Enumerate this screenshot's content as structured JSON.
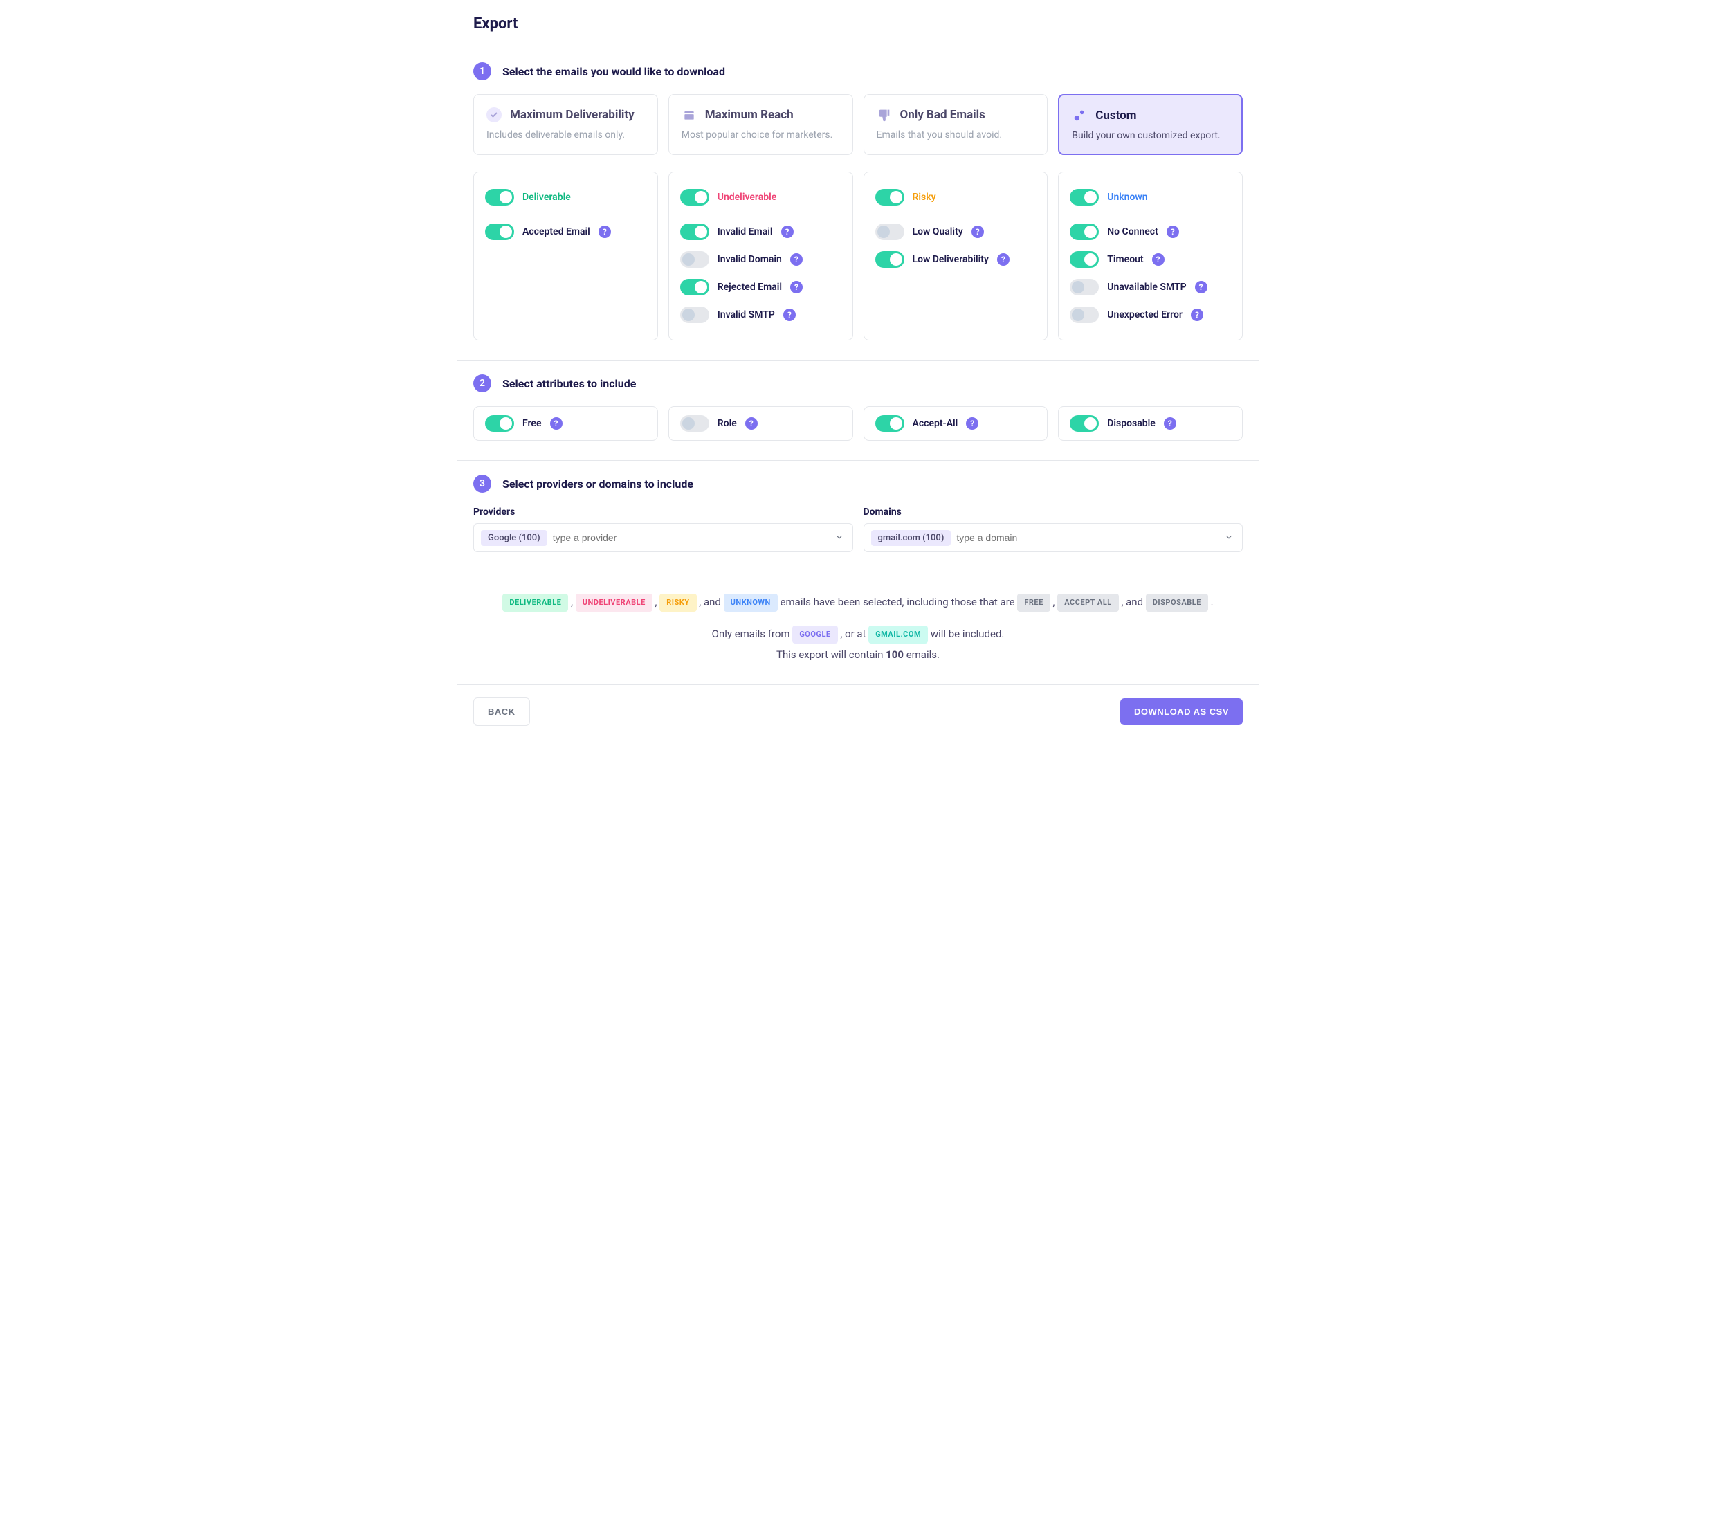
{
  "page": {
    "title": "Export"
  },
  "step1": {
    "num": "1",
    "title": "Select the emails you would like to download",
    "presets": [
      {
        "title": "Maximum Deliverability",
        "desc": "Includes deliverable emails only."
      },
      {
        "title": "Maximum Reach",
        "desc": "Most popular choice for marketers."
      },
      {
        "title": "Only Bad Emails",
        "desc": "Emails that you should avoid."
      },
      {
        "title": "Custom",
        "desc": "Build your own customized export."
      }
    ],
    "categories": {
      "deliverable": {
        "label": "Deliverable",
        "on": true,
        "items": [
          {
            "label": "Accepted Email",
            "on": true
          }
        ]
      },
      "undeliverable": {
        "label": "Undeliverable",
        "on": true,
        "items": [
          {
            "label": "Invalid Email",
            "on": true
          },
          {
            "label": "Invalid Domain",
            "on": false
          },
          {
            "label": "Rejected Email",
            "on": true
          },
          {
            "label": "Invalid SMTP",
            "on": false
          }
        ]
      },
      "risky": {
        "label": "Risky",
        "on": true,
        "items": [
          {
            "label": "Low Quality",
            "on": false
          },
          {
            "label": "Low Deliverability",
            "on": true
          }
        ]
      },
      "unknown": {
        "label": "Unknown",
        "on": true,
        "items": [
          {
            "label": "No Connect",
            "on": true
          },
          {
            "label": "Timeout",
            "on": true
          },
          {
            "label": "Unavailable SMTP",
            "on": false
          },
          {
            "label": "Unexpected Error",
            "on": false
          }
        ]
      }
    }
  },
  "step2": {
    "num": "2",
    "title": "Select attributes to include",
    "attrs": [
      {
        "label": "Free",
        "on": true
      },
      {
        "label": "Role",
        "on": false
      },
      {
        "label": "Accept-All",
        "on": true
      },
      {
        "label": "Disposable",
        "on": true
      }
    ]
  },
  "step3": {
    "num": "3",
    "title": "Select providers or domains to include",
    "providers": {
      "label": "Providers",
      "chip": "Google (100)",
      "placeholder": "type a provider"
    },
    "domains": {
      "label": "Domains",
      "chip": "gmail.com (100)",
      "placeholder": "type a domain"
    }
  },
  "summary": {
    "pills": {
      "deliverable": "DELIVERABLE",
      "undeliverable": "UNDELIVERABLE",
      "risky": "RISKY",
      "unknown": "UNKNOWN",
      "free": "FREE",
      "acceptAll": "ACCEPT ALL",
      "disposable": "DISPOSABLE",
      "google": "GOOGLE",
      "gmail": "GMAIL.COM"
    },
    "text1a": " emails have been selected, including those that are ",
    "text1and": ", and ",
    "text2a": "Only emails from ",
    "text2b": ", or at ",
    "text2c": " will be included.",
    "text3a": "This export will contain ",
    "count": "100",
    "text3b": " emails."
  },
  "footer": {
    "back": "BACK",
    "download": "DOWNLOAD AS CSV"
  }
}
